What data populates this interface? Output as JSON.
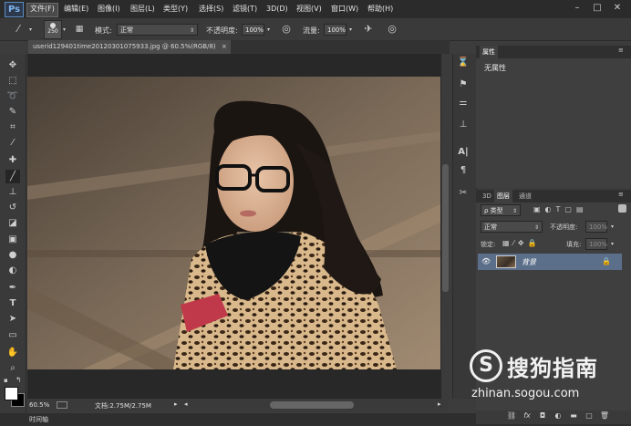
{
  "app": {
    "logo": "Ps"
  },
  "menu": [
    "文件(F)",
    "编辑(E)",
    "图像(I)",
    "图层(L)",
    "类型(Y)",
    "选择(S)",
    "滤镜(T)",
    "3D(D)",
    "视图(V)",
    "窗口(W)",
    "帮助(H)"
  ],
  "window_buttons": {
    "minimize": "–",
    "restore": "□",
    "close": "✕"
  },
  "options": {
    "brush_size": "250",
    "mode_label": "模式:",
    "mode_value": "正常",
    "opacity_label": "不透明度:",
    "opacity_value": "100%",
    "flow_label": "流量:",
    "flow_value": "100%"
  },
  "document": {
    "tab_title": "userid129401time20120301075933.jpg @ 60.5%(RGB/8)",
    "tab_close": "×",
    "zoom": "60.5%",
    "doc_info": "文档:2.75M/2.75M"
  },
  "timeline_label": "时间轴",
  "properties": {
    "tab": "属性",
    "empty_text": "无属性"
  },
  "layers_panel": {
    "tabs": [
      "3D",
      "图层",
      "通道"
    ],
    "filter_label": "ρ 类型",
    "blend_mode": "正常",
    "opacity_label": "不透明度:",
    "opacity_value": "100%",
    "lock_label": "锁定:",
    "fill_label": "填充:",
    "fill_value": "100%",
    "layers": [
      {
        "name": "背景",
        "visible": true,
        "locked": true
      }
    ]
  },
  "watermark": {
    "logo": "S",
    "name": "搜狗指南",
    "url": "zhinan.sogou.com"
  },
  "icons": {
    "tools": [
      "move-icon",
      "marquee-icon",
      "lasso-icon",
      "quick-select-icon",
      "crop-icon",
      "eyedropper-icon",
      "healing-icon",
      "brush-icon",
      "stamp-icon",
      "history-brush-icon",
      "eraser-icon",
      "gradient-icon",
      "blur-icon",
      "dodge-icon",
      "pen-icon",
      "type-icon",
      "path-select-icon",
      "shape-icon",
      "hand-icon",
      "zoom-icon"
    ]
  }
}
